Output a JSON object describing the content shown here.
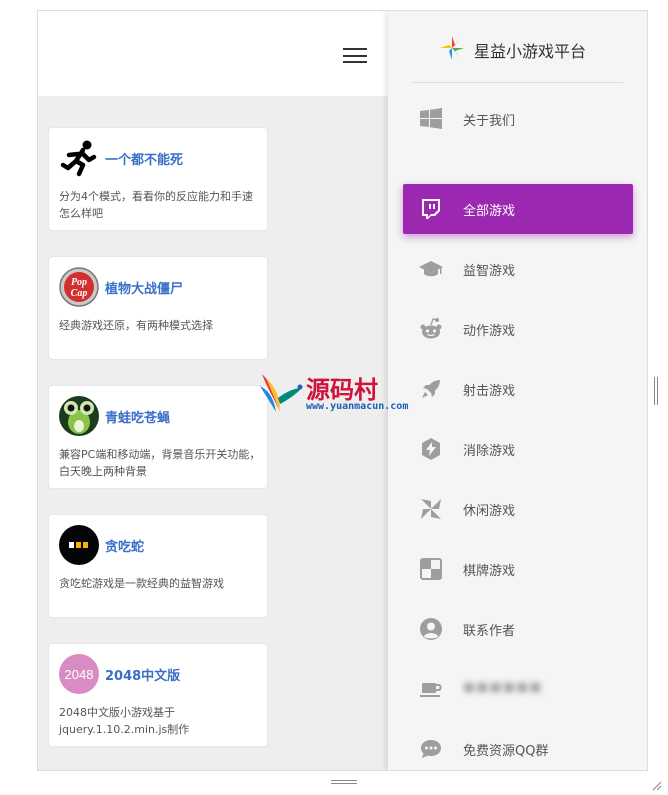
{
  "brand": {
    "name": "星益小游戏平台"
  },
  "games": [
    {
      "title": "一个都不能死",
      "desc": "分为4个模式，看看你的反应能力和手速怎么样吧",
      "icon": "running-man-icon"
    },
    {
      "title": "植物大战僵尸",
      "desc": "经典游戏还原，有两种模式选择",
      "icon": "popcap-logo-icon",
      "logo_text": [
        "Pop",
        "Cap"
      ]
    },
    {
      "title": "青蛙吃苍蝇",
      "desc": "兼容PC端和移动端，背景音乐开关功能，白天晚上两种背景",
      "icon": "frog-icon"
    },
    {
      "title": "贪吃蛇",
      "desc": "贪吃蛇游戏是一款经典的益智游戏",
      "icon": "snake-icon"
    },
    {
      "title": "2048中文版",
      "desc": "2048中文版小游戏基于jquery.1.10.2.min.js制作",
      "icon": "game-2048-icon",
      "logo_text": "2048"
    }
  ],
  "nav": [
    {
      "label": "关于我们",
      "icon": "windows-icon"
    },
    {
      "label": "全部游戏",
      "icon": "twitch-icon",
      "active": true
    },
    {
      "label": "益智游戏",
      "icon": "graduation-cap-icon"
    },
    {
      "label": "动作游戏",
      "icon": "reddit-icon"
    },
    {
      "label": "射击游戏",
      "icon": "rocket-icon"
    },
    {
      "label": "消除游戏",
      "icon": "hexagon-bolt-icon"
    },
    {
      "label": "休闲游戏",
      "icon": "pinwheel-icon"
    },
    {
      "label": "棋牌游戏",
      "icon": "checkerboard-icon"
    },
    {
      "label": "联系作者",
      "icon": "user-circle-icon"
    },
    {
      "label": "■■■■■■",
      "icon": "coffee-cup-icon",
      "blurred": true
    },
    {
      "label": "免费资源QQ群",
      "icon": "chat-bubble-icon"
    }
  ],
  "watermark": {
    "text": "源码村",
    "url": "www.yuanmacun.com"
  },
  "colors": {
    "accent": "#9c27b0",
    "title_blue": "#3a6fc9",
    "icon_gray": "#9e9e9e"
  }
}
